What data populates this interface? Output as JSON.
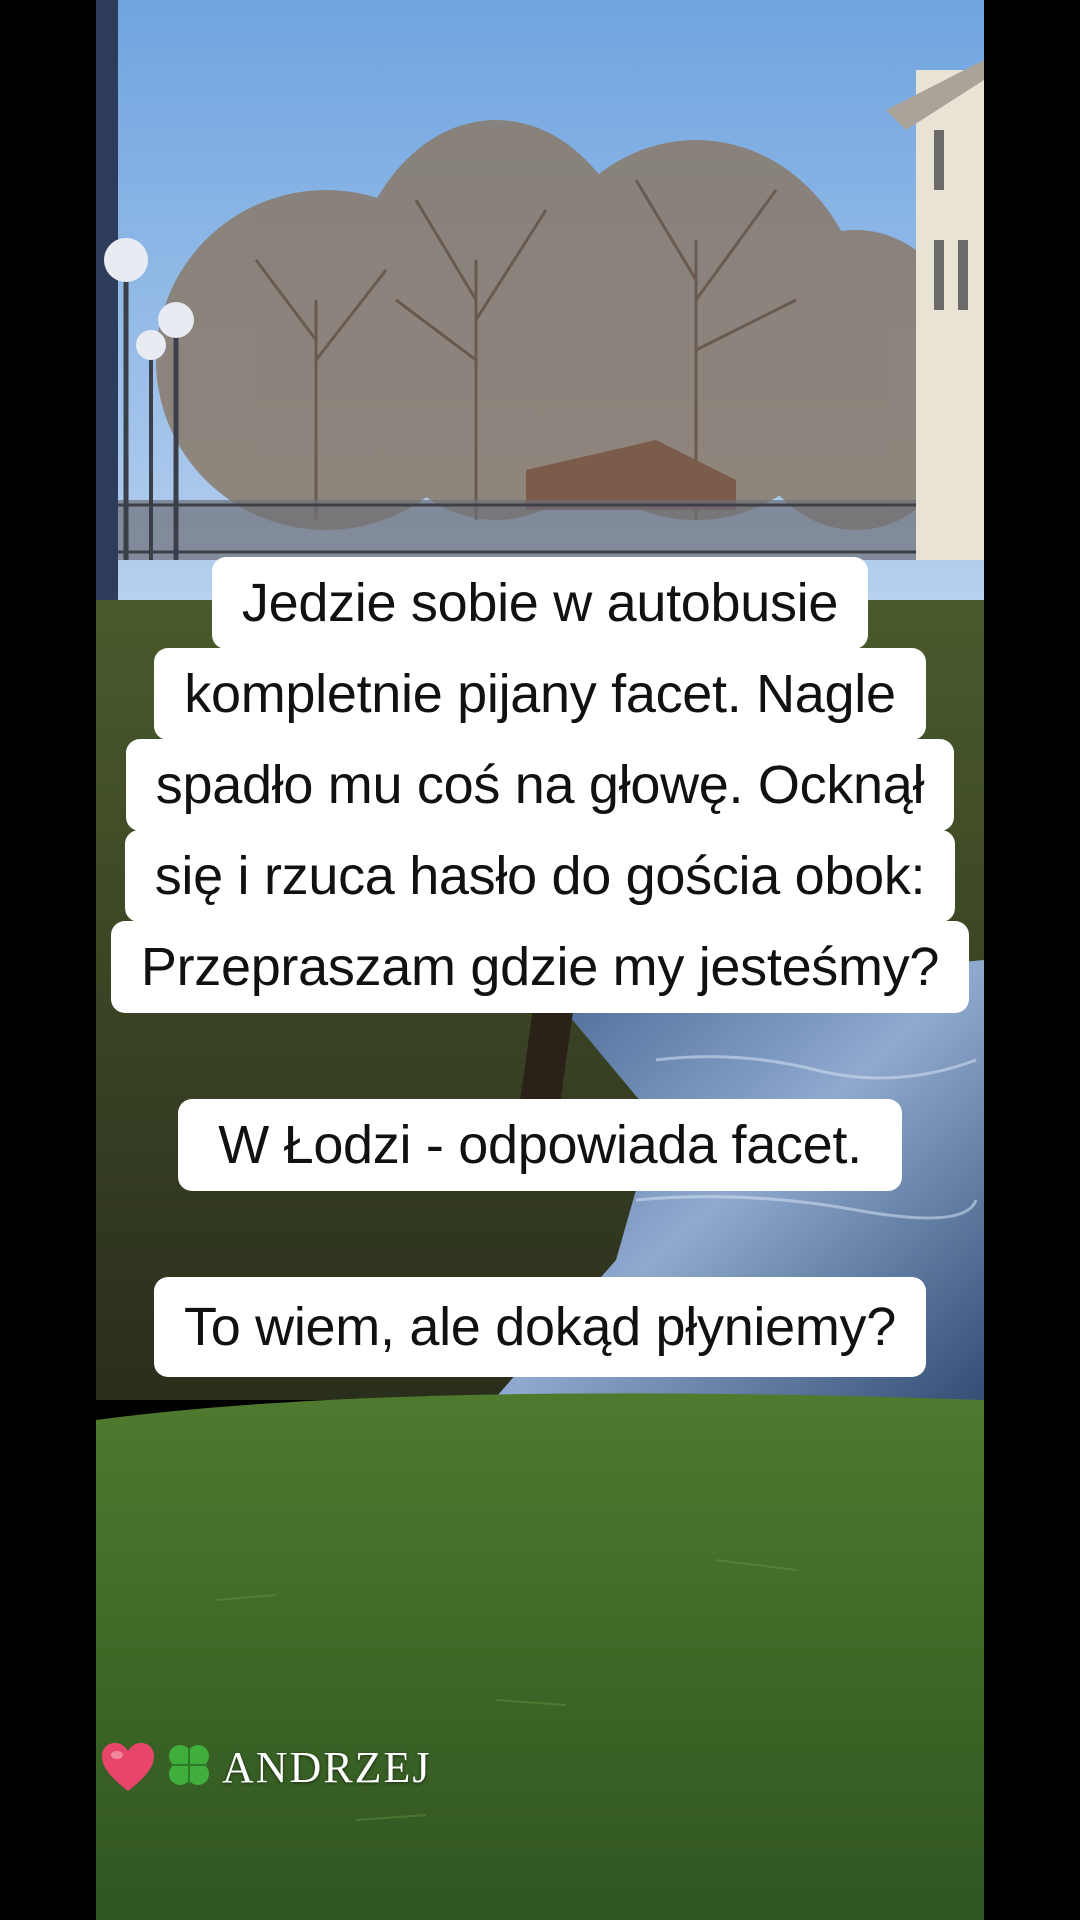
{
  "captions": {
    "block1": {
      "line1": "Jedzie sobie w autobusie",
      "line2": "kompletnie pijany facet. Nagle",
      "line3": "spadło mu coś na głowę. Ocknął",
      "line4": "się i rzuca hasło do gościa obok:",
      "line5": "Przepraszam gdzie my jesteśmy?"
    },
    "block2": {
      "line1": "W Łodzi - odpowiada facet."
    },
    "block3": {
      "line1": "To wiem, ale dokąd płyniemy?"
    }
  },
  "signature": {
    "icons": [
      "heart-icon",
      "clover-icon"
    ],
    "text": "ANDRZEJ",
    "heart_color": "#e8456b",
    "clover_color": "#3fae3a"
  }
}
